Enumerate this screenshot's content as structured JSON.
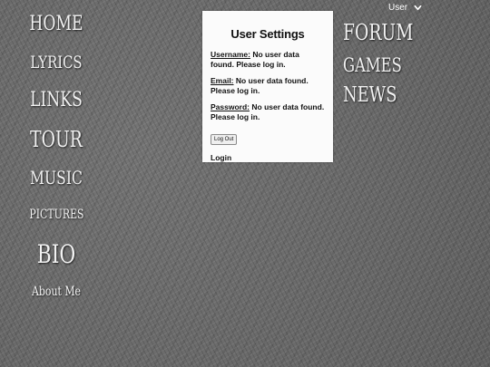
{
  "nav_left": {
    "home": "HOME",
    "lyrics": "LYRICS",
    "links": "LINKS",
    "tour": "TOUR",
    "music": "MUSIC",
    "pictures": "PICTURES",
    "bio": "BIO",
    "about": "About Me"
  },
  "nav_right": {
    "forum": "FORUM",
    "games": "GAMES",
    "news": "NEWS"
  },
  "user_menu": {
    "label": "User",
    "icon": "chevron-down-icon"
  },
  "settings": {
    "title": "User Settings",
    "username_label": "Username:",
    "username_value": "No user data found. Please log in.",
    "email_label": "Email:",
    "email_value": "No user data found. Please log in.",
    "password_label": "Password:",
    "password_value": "No user data found. Please log in.",
    "logout_label": "Log Out",
    "login_label": "Login"
  },
  "colors": {
    "background": "#6e6e6e",
    "panel": "#fbfbfb",
    "nav_text": "#f2f2f2"
  }
}
